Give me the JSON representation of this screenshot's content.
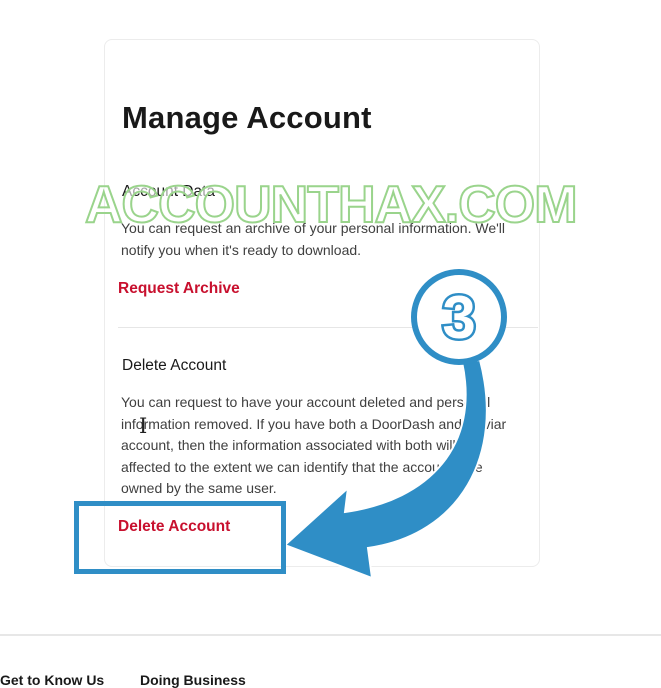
{
  "page": {
    "title": "Manage Account"
  },
  "account_data": {
    "heading": "Account Data",
    "description": "You can request an archive of your personal information. We'll notify you when it's ready to download.",
    "link_label": "Request Archive"
  },
  "delete_account": {
    "heading": "Delete Account",
    "description": "You can request to have your account deleted and personal information removed. If you have both a DoorDash and Caviar account, then the information associated with both will be affected to the extent we can identify that the accounts are owned by the same user.",
    "link_label": "Delete Account"
  },
  "footer": {
    "col1": "Get to Know Us",
    "col2": "Doing Business"
  },
  "overlay": {
    "watermark": "ACCOUNTHAX.COM",
    "step_number": "3",
    "accent_color": "#2f8ec6",
    "icon": "curved-arrow-icon"
  },
  "colors": {
    "link": "#c8102e",
    "text": "#191919"
  }
}
